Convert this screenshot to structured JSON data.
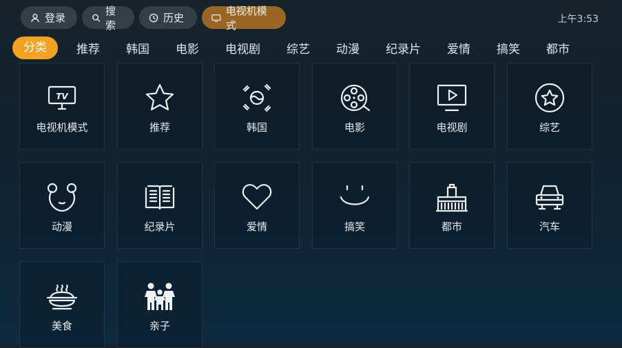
{
  "topbar": {
    "login": "登录",
    "search": "搜索",
    "history": "历史",
    "tvmode": "电视机模式"
  },
  "clock": "上午3:53",
  "tabs": [
    "分类",
    "推荐",
    "韩国",
    "电影",
    "电视剧",
    "综艺",
    "动漫",
    "纪录片",
    "爱情",
    "搞笑",
    "都市"
  ],
  "cards": [
    {
      "label": "电视机模式",
      "icon": "tv-icon"
    },
    {
      "label": "推荐",
      "icon": "star-icon"
    },
    {
      "label": "韩国",
      "icon": "korea-flag-icon"
    },
    {
      "label": "电影",
      "icon": "film-reel-icon"
    },
    {
      "label": "电视剧",
      "icon": "play-screen-icon"
    },
    {
      "label": "综艺",
      "icon": "star-badge-icon"
    },
    {
      "label": "动漫",
      "icon": "bear-icon"
    },
    {
      "label": "纪录片",
      "icon": "book-icon"
    },
    {
      "label": "爱情",
      "icon": "heart-icon"
    },
    {
      "label": "搞笑",
      "icon": "smile-icon"
    },
    {
      "label": "都市",
      "icon": "city-building-icon"
    },
    {
      "label": "汽车",
      "icon": "car-icon"
    },
    {
      "label": "美食",
      "icon": "food-bowl-icon"
    },
    {
      "label": "亲子",
      "icon": "parent-child-icon"
    }
  ],
  "colors": {
    "active_tab": "#f4a223",
    "active_pill": "#9a6626"
  },
  "tv_icon_text": "TV"
}
